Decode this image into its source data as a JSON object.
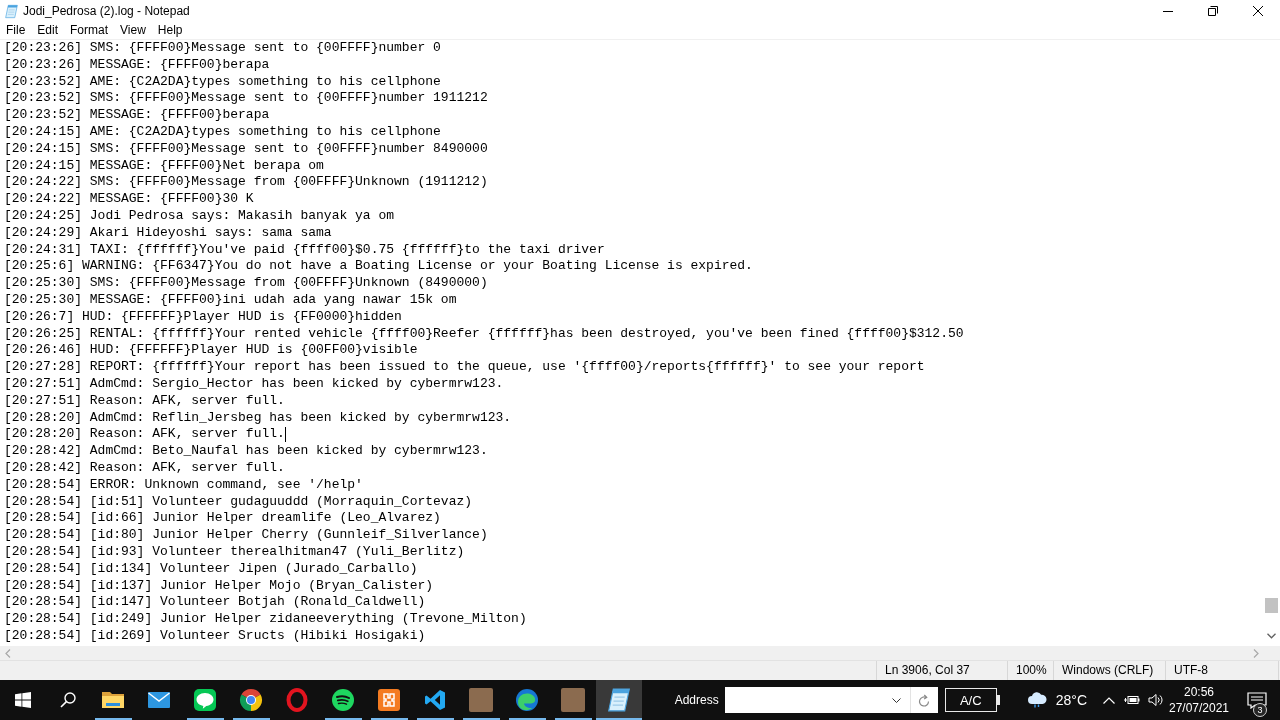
{
  "window": {
    "title": "Jodi_Pedrosa (2).log - Notepad"
  },
  "menu": [
    "File",
    "Edit",
    "Format",
    "View",
    "Help"
  ],
  "editor": {
    "lines": [
      {
        "text": "[20:23:26] SMS: {FFFF00}Message sent to {00FFFF}number 0",
        "caret": false
      },
      {
        "text": "[20:23:26] MESSAGE: {FFFF00}berapa",
        "caret": false
      },
      {
        "text": "[20:23:52] AME: {C2A2DA}types something to his cellphone",
        "caret": false
      },
      {
        "text": "[20:23:52] SMS: {FFFF00}Message sent to {00FFFF}number 1911212",
        "caret": false
      },
      {
        "text": "[20:23:52] MESSAGE: {FFFF00}berapa",
        "caret": false
      },
      {
        "text": "[20:24:15] AME: {C2A2DA}types something to his cellphone",
        "caret": false
      },
      {
        "text": "[20:24:15] SMS: {FFFF00}Message sent to {00FFFF}number 8490000",
        "caret": false
      },
      {
        "text": "[20:24:15] MESSAGE: {FFFF00}Net berapa om",
        "caret": false
      },
      {
        "text": "[20:24:22] SMS: {FFFF00}Message from {00FFFF}Unknown (1911212)",
        "caret": false
      },
      {
        "text": "[20:24:22] MESSAGE: {FFFF00}30 K",
        "caret": false
      },
      {
        "text": "[20:24:25] Jodi Pedrosa says: Makasih banyak ya om",
        "caret": false
      },
      {
        "text": "[20:24:29] Akari Hideyoshi says: sama sama",
        "caret": false
      },
      {
        "text": "[20:24:31] TAXI: {ffffff}You've paid {ffff00}$0.75 {ffffff}to the taxi driver",
        "caret": false
      },
      {
        "text": "[20:25:6] WARNING: {FF6347}You do not have a Boating License or your Boating License is expired.",
        "caret": false
      },
      {
        "text": "[20:25:30] SMS: {FFFF00}Message from {00FFFF}Unknown (8490000)",
        "caret": false
      },
      {
        "text": "[20:25:30] MESSAGE: {FFFF00}ini udah ada yang nawar 15k om",
        "caret": false
      },
      {
        "text": "[20:26:7] HUD: {FFFFFF}Player HUD is {FF0000}hidden",
        "caret": false
      },
      {
        "text": "[20:26:25] RENTAL: {ffffff}Your rented vehicle {ffff00}Reefer {ffffff}has been destroyed, you've been fined {ffff00}$312.50",
        "caret": false
      },
      {
        "text": "[20:26:46] HUD: {FFFFFF}Player HUD is {00FF00}visible",
        "caret": false
      },
      {
        "text": "[20:27:28] REPORT: {ffffff}Your report has been issued to the queue, use '{ffff00}/reports{ffffff}' to see your report",
        "caret": false
      },
      {
        "text": "[20:27:51] AdmCmd: Sergio_Hector has been kicked by cybermrw123.",
        "caret": false
      },
      {
        "text": "[20:27:51] Reason: AFK, server full.",
        "caret": false
      },
      {
        "text": "[20:28:20] AdmCmd: Reflin_Jersbeg has been kicked by cybermrw123.",
        "caret": false
      },
      {
        "text": "[20:28:20] Reason: AFK, server full.",
        "caret": true
      },
      {
        "text": "[20:28:42] AdmCmd: Beto_Naufal has been kicked by cybermrw123.",
        "caret": false
      },
      {
        "text": "[20:28:42] Reason: AFK, server full.",
        "caret": false
      },
      {
        "text": "[20:28:54] ERROR: Unknown command, see '/help'",
        "caret": false
      },
      {
        "text": "[20:28:54] [id:51] Volunteer gudaguuddd (Morraquin_Cortevaz)",
        "caret": false
      },
      {
        "text": "[20:28:54] [id:66] Junior Helper dreamlife (Leo_Alvarez)",
        "caret": false
      },
      {
        "text": "[20:28:54] [id:80] Junior Helper Cherry (Gunnleif_Silverlance)",
        "caret": false
      },
      {
        "text": "[20:28:54] [id:93] Volunteer therealhitman47 (Yuli_Berlitz)",
        "caret": false
      },
      {
        "text": "[20:28:54] [id:134] Volunteer Jipen (Jurado_Carballo)",
        "caret": false
      },
      {
        "text": "[20:28:54] [id:137] Junior Helper Mojo (Bryan_Calister)",
        "caret": false
      },
      {
        "text": "[20:28:54] [id:147] Volunteer Botjah (Ronald_Caldwell)",
        "caret": false
      },
      {
        "text": "[20:28:54] [id:249] Junior Helper zidaneeverything (Trevone_Milton)",
        "caret": false
      },
      {
        "text": "[20:28:54] [id:269] Volunteer Sructs (Hibiki Hosigaki)",
        "caret": false
      }
    ]
  },
  "status_bar": {
    "position": "Ln 3906, Col 37",
    "zoom": "100%",
    "line_ending": "Windows (CRLF)",
    "encoding": "UTF-8"
  },
  "taskbar": {
    "apps": [
      {
        "kind": "folder",
        "running": true,
        "active": false
      },
      {
        "kind": "mail",
        "running": false,
        "active": false
      },
      {
        "kind": "chat",
        "running": true,
        "active": false
      },
      {
        "kind": "tricolor",
        "running": true,
        "active": false
      },
      {
        "kind": "ring",
        "running": false,
        "active": false
      },
      {
        "kind": "music",
        "running": true,
        "active": false
      },
      {
        "kind": "tile",
        "running": true,
        "active": false
      },
      {
        "kind": "code",
        "running": true,
        "active": false
      },
      {
        "kind": "picture",
        "running": true,
        "active": false
      },
      {
        "kind": "swirl",
        "running": true,
        "active": false
      },
      {
        "kind": "picture",
        "running": true,
        "active": false
      },
      {
        "kind": "notepad",
        "running": true,
        "active": true
      }
    ],
    "address": {
      "label": "Address"
    },
    "power": "A/C",
    "weather": {
      "temperature": "28°C"
    },
    "clock": {
      "time": "20:56",
      "date": "27/07/2021"
    },
    "notifications": {
      "count": "3"
    }
  }
}
